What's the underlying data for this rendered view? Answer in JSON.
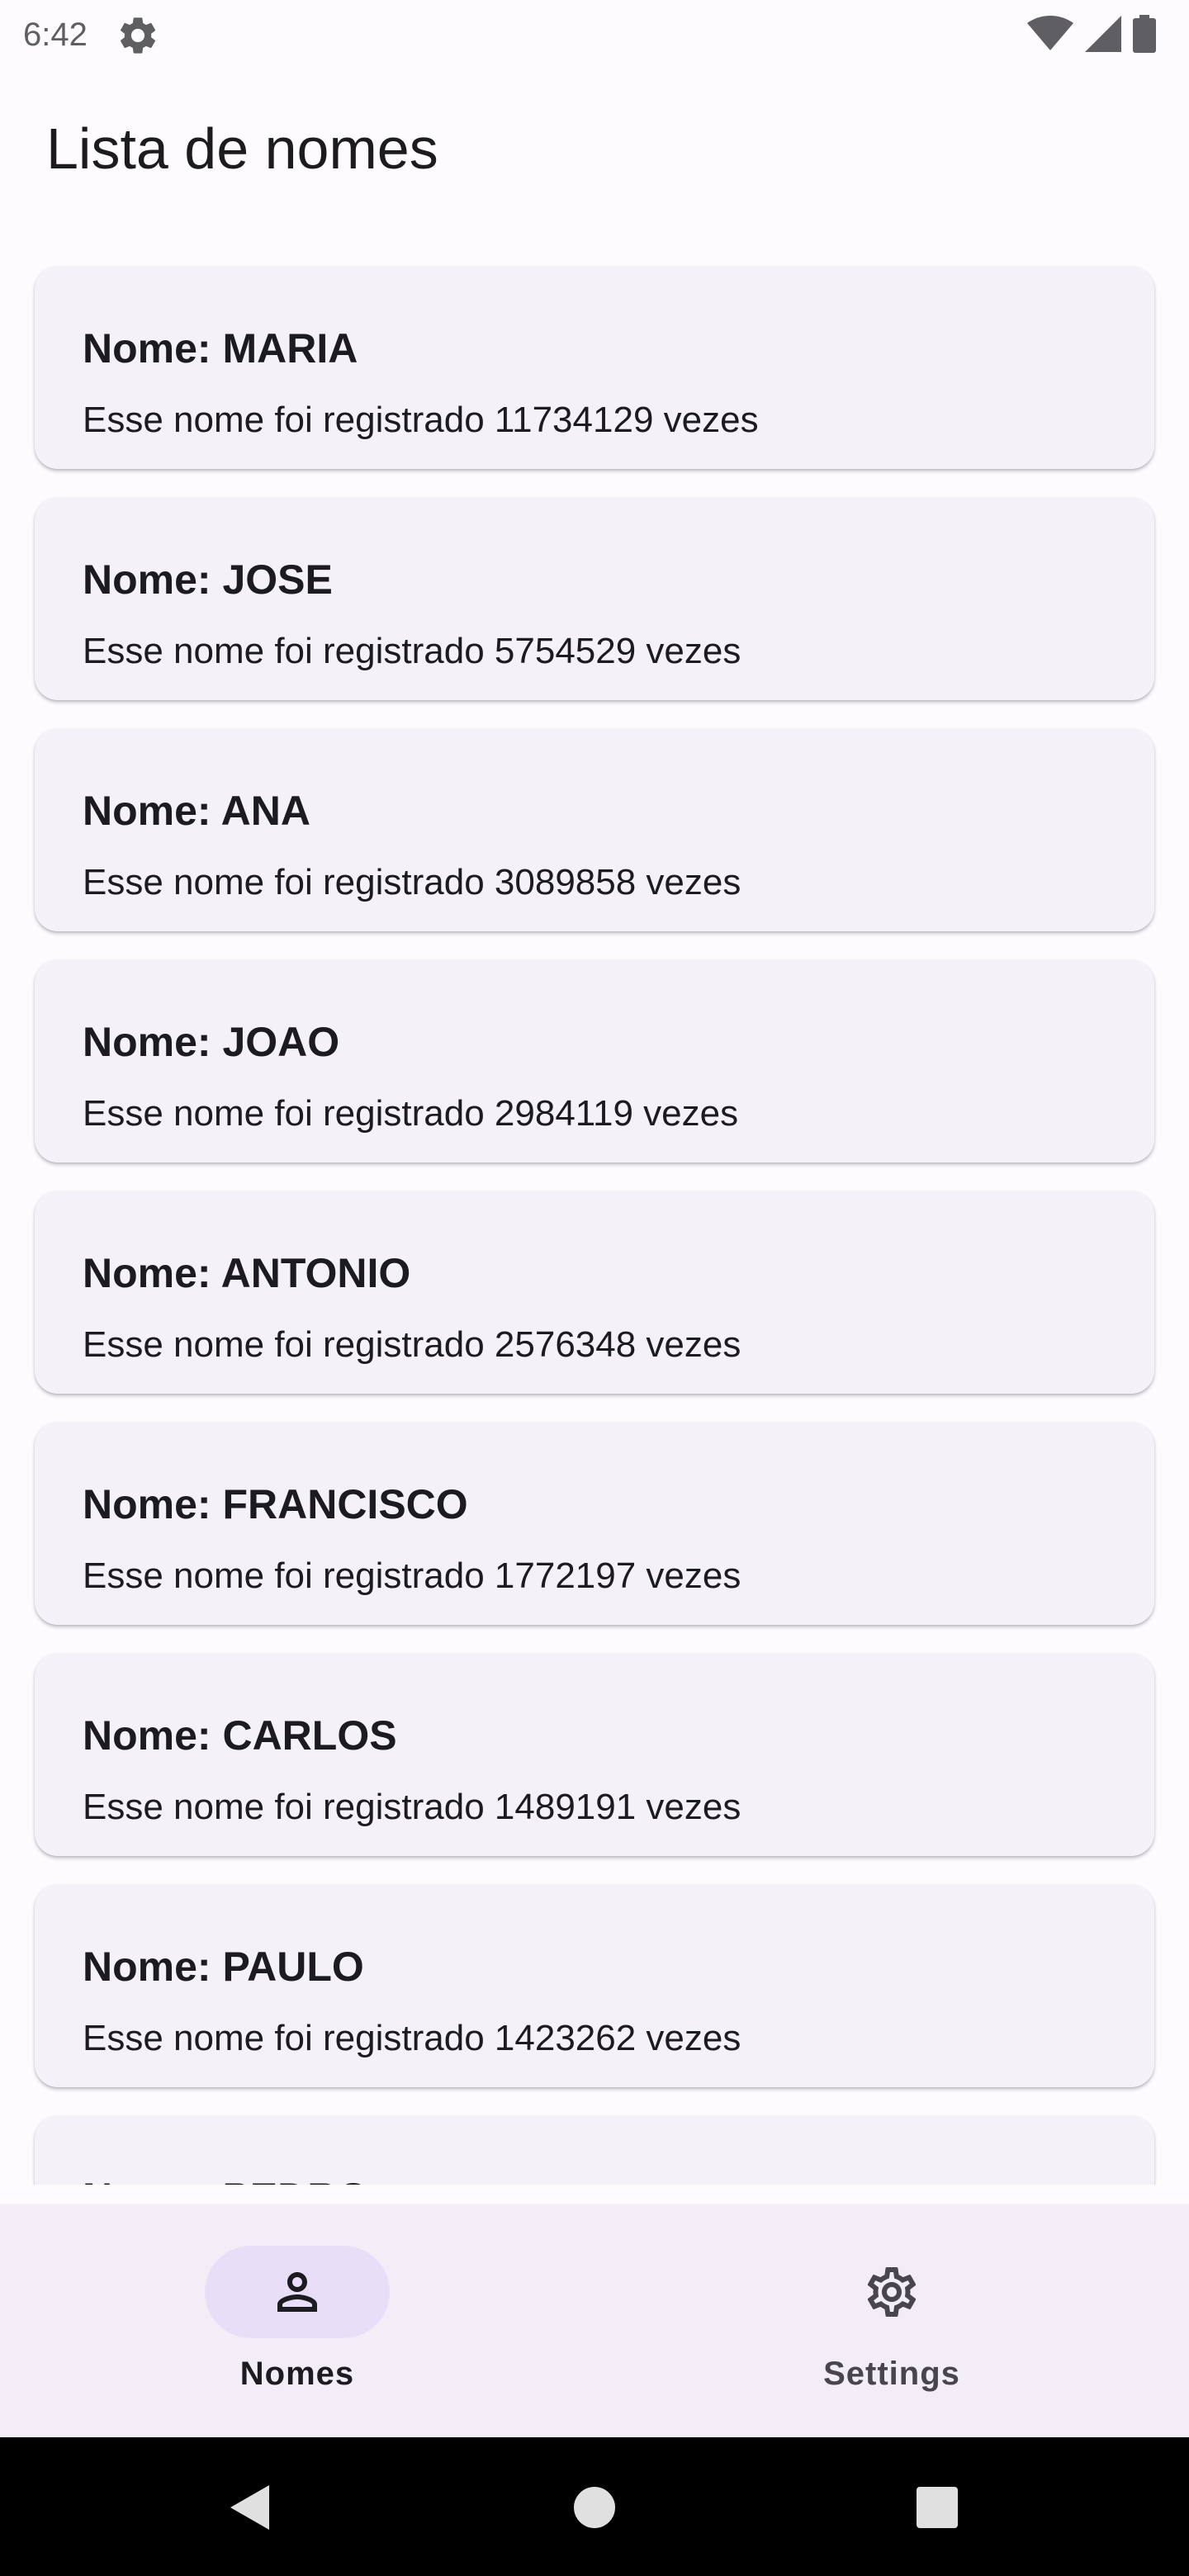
{
  "status_bar": {
    "time": "6:42",
    "icons": [
      "settings-gear-icon",
      "wifi-icon",
      "cell-signal-icon",
      "battery-icon"
    ]
  },
  "app_bar": {
    "title": "Lista de nomes"
  },
  "names": [
    {
      "title": "Nome: MARIA",
      "subtitle": "Esse nome foi registrado 11734129 vezes"
    },
    {
      "title": "Nome: JOSE",
      "subtitle": "Esse nome foi registrado 5754529 vezes"
    },
    {
      "title": "Nome: ANA",
      "subtitle": "Esse nome foi registrado 3089858 vezes"
    },
    {
      "title": "Nome: JOAO",
      "subtitle": "Esse nome foi registrado 2984119 vezes"
    },
    {
      "title": "Nome: ANTONIO",
      "subtitle": "Esse nome foi registrado 2576348 vezes"
    },
    {
      "title": "Nome: FRANCISCO",
      "subtitle": "Esse nome foi registrado 1772197 vezes"
    },
    {
      "title": "Nome: CARLOS",
      "subtitle": "Esse nome foi registrado 1489191 vezes"
    },
    {
      "title": "Nome: PAULO",
      "subtitle": "Esse nome foi registrado 1423262 vezes"
    },
    {
      "title": "Nome: PEDRO",
      "subtitle": ""
    }
  ],
  "bottom_nav": {
    "items": [
      {
        "label": "Nomes",
        "icon": "person-icon",
        "active": true
      },
      {
        "label": "Settings",
        "icon": "gear-icon",
        "active": false
      }
    ]
  },
  "system_nav": {
    "icons": [
      "back-icon",
      "home-icon",
      "recents-icon"
    ]
  },
  "colors": {
    "background": "#fefbff",
    "card": "#f5f1f8",
    "nav_background": "#f3edf7",
    "nav_active_pill": "#e8def8",
    "text": "#1c1b1f"
  }
}
